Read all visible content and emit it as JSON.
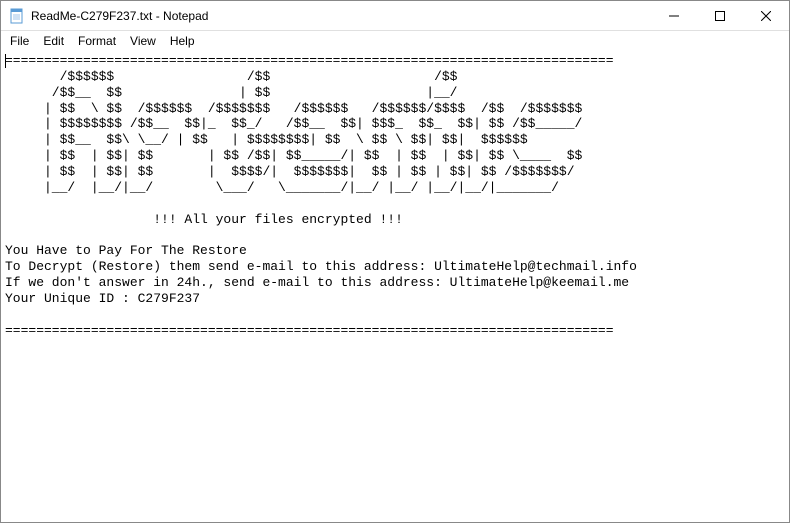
{
  "titlebar": {
    "title": "ReadMe-C279F237.txt - Notepad"
  },
  "menubar": {
    "file": "File",
    "edit": "Edit",
    "format": "Format",
    "view": "View",
    "help": "Help"
  },
  "content": {
    "text": "==============================================================================\n       /$$$$$$                 /$$                     /$$\n      /$$__  $$               | $$                    |__/\n     | $$  \\ $$  /$$$$$$  /$$$$$$$   /$$$$$$   /$$$$$$/$$$$  /$$  /$$$$$$$\n     | $$$$$$$$ /$$__  $$|_  $$_/   /$$__  $$| $$$_  $$_  $$| $$ /$$_____/\n     | $$__  $$\\ \\__/ | $$   | $$$$$$$$| $$  \\ $$ \\ $$| $$|  $$$$$$\n     | $$  | $$| $$       | $$ /$$| $$_____/| $$  | $$  | $$| $$ \\____  $$\n     | $$  | $$| $$       |  $$$$/|  $$$$$$$|  $$ | $$ | $$| $$ /$$$$$$$/\n     |__/  |__/|__/        \\___/   \\_______/|__/ |__/ |__/|__/|_______/\n\n                   !!! All your files encrypted !!!\n\nYou Have to Pay For The Restore\nTo Decrypt (Restore) them send e-mail to this address: UltimateHelp@techmail.info\nIf we don't answer in 24h., send e-mail to this address: UltimateHelp@keemail.me\nYour Unique ID : C279F237\n\n=============================================================================="
  }
}
